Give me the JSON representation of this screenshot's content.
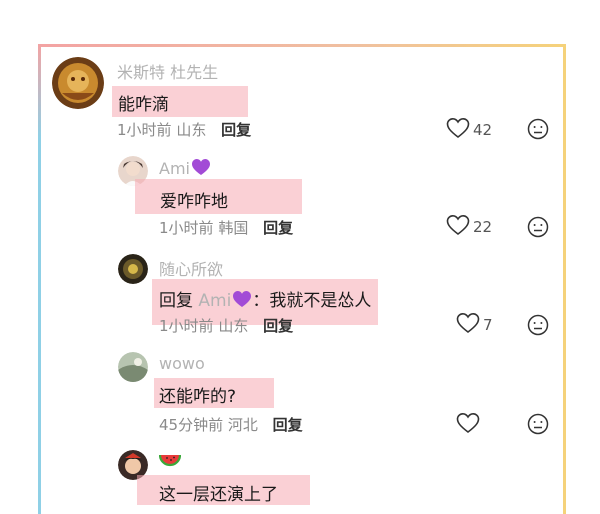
{
  "comments": [
    {
      "username": "米斯特 杜先生",
      "content": "能咋滴",
      "time": "1小时前",
      "location": "山东",
      "reply_label": "回复",
      "likes": "42"
    },
    {
      "username": "Ami",
      "content": "爱咋咋地",
      "time": "1小时前",
      "location": "韩国",
      "reply_label": "回复",
      "likes": "22"
    },
    {
      "username": "随心所欲",
      "reply_prefix": "回复",
      "mention": "Ami",
      "content": "：我就不是怂人",
      "time": "1小时前",
      "location": "山东",
      "reply_label": "回复",
      "likes": "7"
    },
    {
      "username": "wowo",
      "content": "还能咋的?",
      "time": "45分钟前",
      "location": "河北",
      "reply_label": "回复",
      "likes": ""
    },
    {
      "username": "",
      "content": "这一层还演上了"
    }
  ],
  "icons": {
    "like": "heart-outline-icon",
    "reaction": "neutral-face-icon",
    "purple_heart": "purple-heart-emoji",
    "watermelon": "watermelon-emoji"
  },
  "colors": {
    "highlight": "#f6aab2",
    "purple_heart": "#a24bd6",
    "username": "#b3b3b3"
  }
}
